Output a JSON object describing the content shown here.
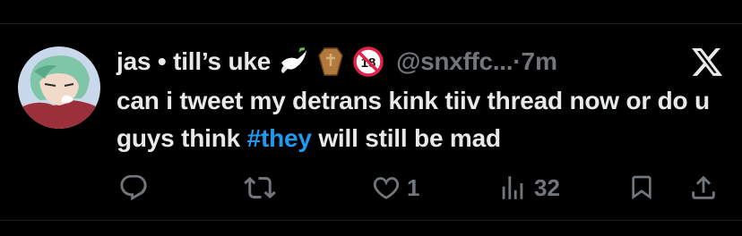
{
  "tweet": {
    "author_name": "jas • till’s uke",
    "handle": "@snxffc...",
    "separator": "·",
    "time": "7m",
    "text_before": "can i tweet my detrans kink tiiv thread now or do u guys think ",
    "hashtag": "#they",
    "text_after": " will still be mad"
  },
  "header_emojis": [
    "dove-icon",
    "coffin-icon",
    "no-one-under-18-icon"
  ],
  "actions": {
    "reply_count": "",
    "retweet_count": "",
    "like_count": "1",
    "views_count": "32"
  },
  "colors": {
    "background": "#000000",
    "text": "#e7e9ea",
    "muted": "#71767b",
    "link": "#1d9bf0"
  }
}
